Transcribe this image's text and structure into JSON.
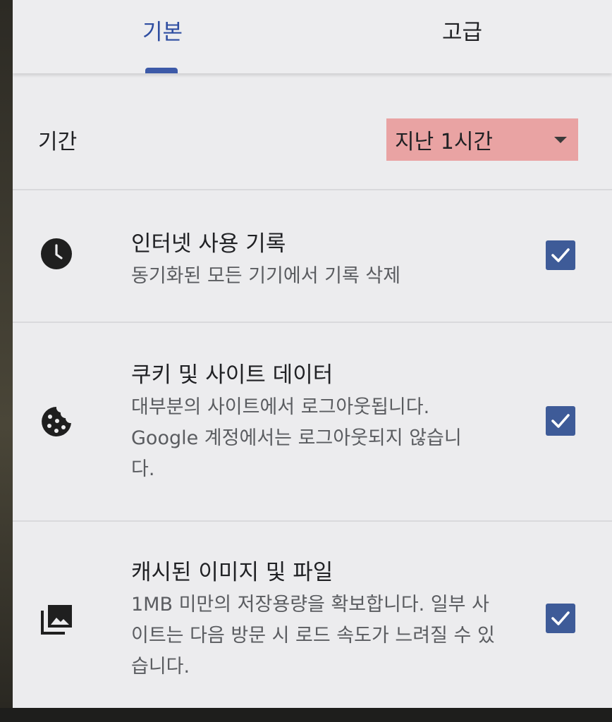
{
  "tabs": [
    {
      "label": "기본",
      "selected": true
    },
    {
      "label": "고급",
      "selected": false
    }
  ],
  "period": {
    "label": "기간",
    "value": "지난 1시간"
  },
  "items": [
    {
      "title": "인터넷 사용 기록",
      "description": "동기화된 모든 기기에서 기록 삭제",
      "icon": "clock-icon",
      "checked": true
    },
    {
      "title": "쿠키 및 사이트 데이터",
      "description": "대부분의 사이트에서 로그아웃됩니다. Google 계정에서는 로그아웃되지 않습니다.",
      "icon": "cookie-icon",
      "checked": true
    },
    {
      "title": "캐시된 이미지 및 파일",
      "description": "1MB 미만의 저장용량을 확보합니다. 일부 사이트는 다음 방문 시 로드 속도가 느려질 수 있습니다.",
      "icon": "image-stack-icon",
      "checked": true
    }
  ],
  "colors": {
    "accent": "#3d5aa8",
    "checkbox": "#3e5b98",
    "dropdown_highlight": "#e9a3a3",
    "background": "#ececee"
  }
}
